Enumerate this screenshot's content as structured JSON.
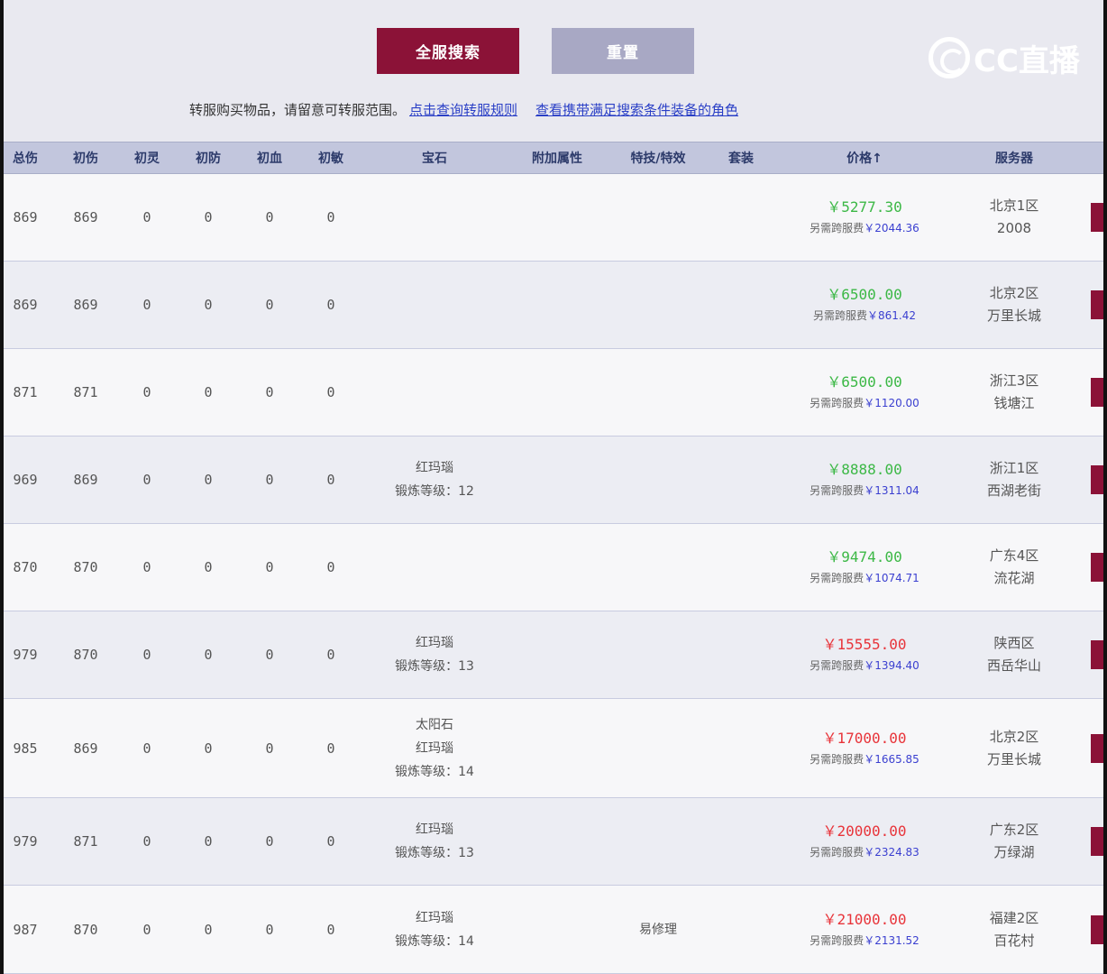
{
  "toolbar": {
    "search_label": "全服搜索",
    "reset_label": "重置",
    "notice_text": "转服购买物品，请留意可转服范围。",
    "rules_link": "点击查询转服规则",
    "match_link": "查看携带满足搜索条件装备的角色"
  },
  "watermark": {
    "text": "CC直播"
  },
  "table": {
    "headers": [
      "总伤",
      "初伤",
      "初灵",
      "初防",
      "初血",
      "初敏",
      "宝石",
      "附加属性",
      "特技/特效",
      "套装",
      "价格↑",
      "服务器"
    ],
    "rows": [
      {
        "total": "869",
        "c1": "869",
        "c2": "0",
        "c3": "0",
        "c4": "0",
        "c5": "0",
        "gems": [],
        "extra": "",
        "skill": "",
        "set": "",
        "price": "￥5277.30",
        "price_color": "green",
        "fee_label": "另需跨服费",
        "fee": "￥2044.36",
        "server": [
          "北京1区",
          "2008"
        ]
      },
      {
        "total": "869",
        "c1": "869",
        "c2": "0",
        "c3": "0",
        "c4": "0",
        "c5": "0",
        "gems": [],
        "extra": "",
        "skill": "",
        "set": "",
        "price": "￥6500.00",
        "price_color": "green",
        "fee_label": "另需跨服费",
        "fee": "￥861.42",
        "server": [
          "北京2区",
          "万里长城"
        ]
      },
      {
        "total": "871",
        "c1": "871",
        "c2": "0",
        "c3": "0",
        "c4": "0",
        "c5": "0",
        "gems": [],
        "extra": "",
        "skill": "",
        "set": "",
        "price": "￥6500.00",
        "price_color": "green",
        "fee_label": "另需跨服费",
        "fee": "￥1120.00",
        "server": [
          "浙江3区",
          "钱塘江"
        ]
      },
      {
        "total": "969",
        "c1": "869",
        "c2": "0",
        "c3": "0",
        "c4": "0",
        "c5": "0",
        "gems": [
          "红玛瑙",
          "锻炼等级：12"
        ],
        "extra": "",
        "skill": "",
        "set": "",
        "price": "￥8888.00",
        "price_color": "green",
        "fee_label": "另需跨服费",
        "fee": "￥1311.04",
        "server": [
          "浙江1区",
          "西湖老街"
        ]
      },
      {
        "total": "870",
        "c1": "870",
        "c2": "0",
        "c3": "0",
        "c4": "0",
        "c5": "0",
        "gems": [],
        "extra": "",
        "skill": "",
        "set": "",
        "price": "￥9474.00",
        "price_color": "green",
        "fee_label": "另需跨服费",
        "fee": "￥1074.71",
        "server": [
          "广东4区",
          "流花湖"
        ]
      },
      {
        "total": "979",
        "c1": "870",
        "c2": "0",
        "c3": "0",
        "c4": "0",
        "c5": "0",
        "gems": [
          "红玛瑙",
          "锻炼等级：13"
        ],
        "extra": "",
        "skill": "",
        "set": "",
        "price": "￥15555.00",
        "price_color": "red",
        "fee_label": "另需跨服费",
        "fee": "￥1394.40",
        "server": [
          "陕西区",
          "西岳华山"
        ]
      },
      {
        "total": "985",
        "c1": "869",
        "c2": "0",
        "c3": "0",
        "c4": "0",
        "c5": "0",
        "gems": [
          "太阳石",
          "红玛瑙",
          "锻炼等级：14"
        ],
        "extra": "",
        "skill": "",
        "set": "",
        "price": "￥17000.00",
        "price_color": "red",
        "fee_label": "另需跨服费",
        "fee": "￥1665.85",
        "server": [
          "北京2区",
          "万里长城"
        ]
      },
      {
        "total": "979",
        "c1": "871",
        "c2": "0",
        "c3": "0",
        "c4": "0",
        "c5": "0",
        "gems": [
          "红玛瑙",
          "锻炼等级：13"
        ],
        "extra": "",
        "skill": "",
        "set": "",
        "price": "￥20000.00",
        "price_color": "red",
        "fee_label": "另需跨服费",
        "fee": "￥2324.83",
        "server": [
          "广东2区",
          "万绿湖"
        ]
      },
      {
        "total": "987",
        "c1": "870",
        "c2": "0",
        "c3": "0",
        "c4": "0",
        "c5": "0",
        "gems": [
          "红玛瑙",
          "锻炼等级：14"
        ],
        "extra": "",
        "skill": "易修理",
        "set": "",
        "price": "￥21000.00",
        "price_color": "red",
        "fee_label": "另需跨服费",
        "fee": "￥2131.52",
        "server": [
          "福建2区",
          "百花村"
        ]
      }
    ]
  }
}
